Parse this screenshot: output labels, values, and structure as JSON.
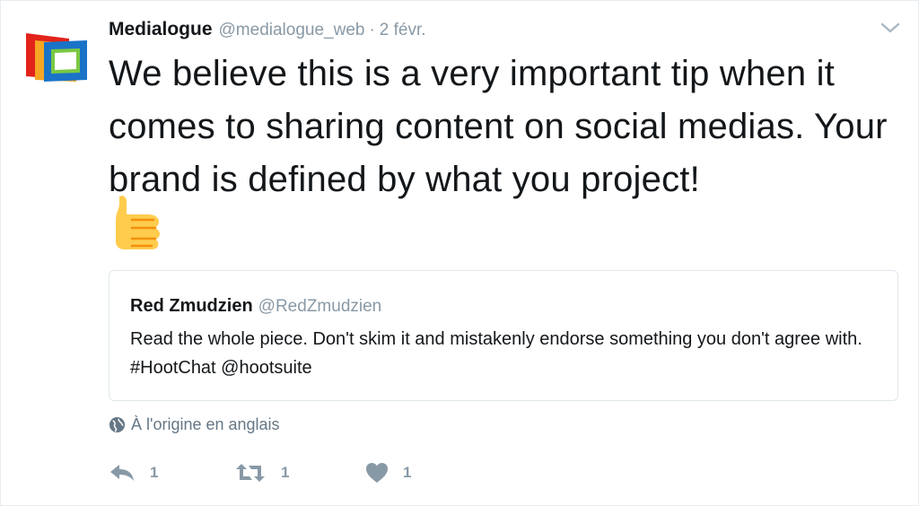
{
  "tweet": {
    "author_name": "Medialogue",
    "author_handle": "@medialogue_web",
    "separator": "·",
    "time": "2 févr.",
    "text": "We believe this is a very important tip when it comes to sharing content on social medias. Your brand is defined by what you project!",
    "emoji": "thumbs-up"
  },
  "quoted": {
    "author_name": "Red Zmudzien",
    "author_handle": "@RedZmudzien",
    "text": "Read the whole piece. Don't skim it and mistakenly endorse something you don't agree with. #HootChat @hootsuite"
  },
  "translate": {
    "label": "À l'origine en anglais",
    "icon": "globe-icon"
  },
  "actions": {
    "reply_count": "1",
    "retweet_count": "1",
    "like_count": "1"
  },
  "colors": {
    "text": "#14171a",
    "muted": "#8899a6",
    "border": "#e1e8ed"
  }
}
